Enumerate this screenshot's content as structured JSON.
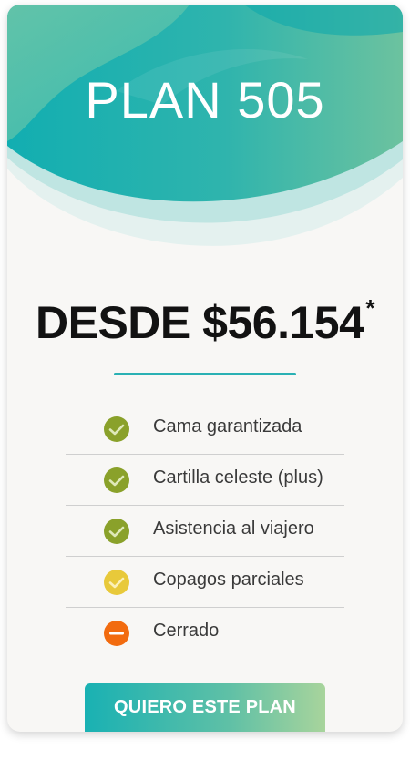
{
  "plan": {
    "title": "PLAN 505",
    "price": "DESDE $56.154",
    "price_note": "*"
  },
  "features": [
    {
      "label": "Cama garantizada",
      "status": "included",
      "icon": "check-icon",
      "color": "#8aa12a"
    },
    {
      "label": "Cartilla celeste (plus)",
      "status": "included",
      "icon": "check-icon",
      "color": "#8aa12a"
    },
    {
      "label": "Asistencia al viajero",
      "status": "included",
      "icon": "check-icon",
      "color": "#8aa12a"
    },
    {
      "label": "Copagos parciales",
      "status": "partial",
      "icon": "check-icon",
      "color": "#e8c93a"
    },
    {
      "label": "Cerrado",
      "status": "excluded",
      "icon": "minus-icon",
      "color": "#f26b0f"
    }
  ],
  "cta": {
    "label": "QUIERO ESTE PLAN"
  },
  "colors": {
    "accent": "#2ab1b4",
    "header_teal": "#14b0b2",
    "header_green": "#7cc4a0"
  }
}
